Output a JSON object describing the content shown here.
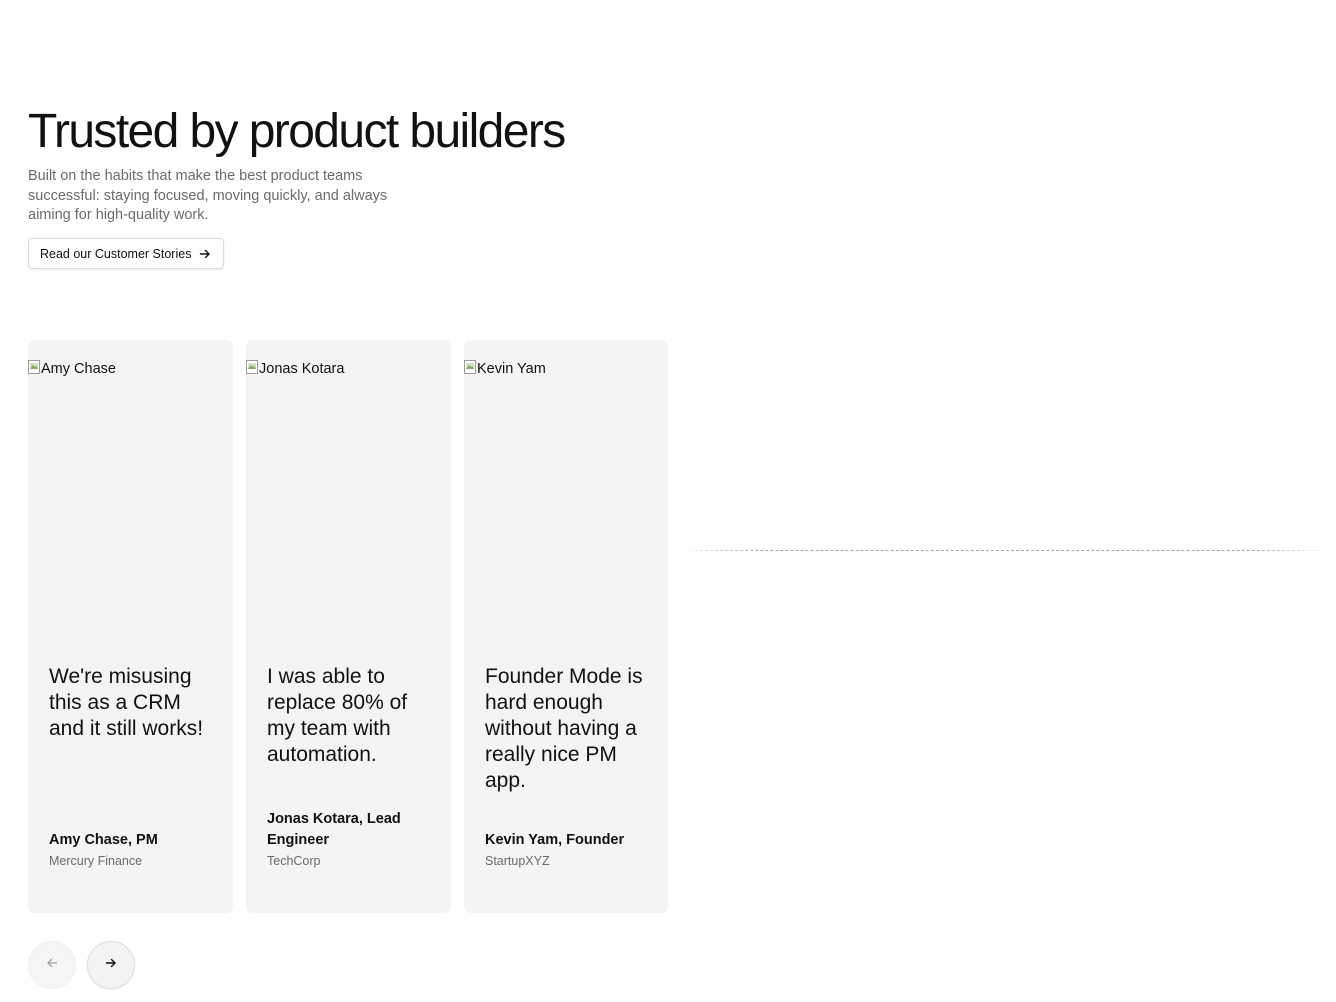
{
  "hero": {
    "title": "Trusted by product builders",
    "subtitle": "Built on the habits that make the best product teams successful: staying focused, moving quickly, and always aiming for high-quality work.",
    "cta_label": "Read our Customer Stories",
    "cta_icon": "arrow-right-icon"
  },
  "testimonials": [
    {
      "image_alt": "Amy Chase",
      "quote": "We're misusing this as a CRM and it still works!",
      "author": "Amy Chase, PM",
      "company": "Mercury Finance"
    },
    {
      "image_alt": "Jonas Kotara",
      "quote": "I was able to replace 80% of my team with automation.",
      "author": "Jonas Kotara, Lead Engineer",
      "company": "TechCorp"
    },
    {
      "image_alt": "Kevin Yam",
      "quote": "Founder Mode is hard enough without having a really nice PM app.",
      "author": "Kevin Yam, Founder",
      "company": "StartupXYZ"
    }
  ],
  "carousel": {
    "prev_icon": "arrow-left-icon",
    "next_icon": "arrow-right-icon"
  },
  "colors": {
    "text": "#111111",
    "muted": "#6b6b6b",
    "card_bg": "#f4f4f4"
  }
}
